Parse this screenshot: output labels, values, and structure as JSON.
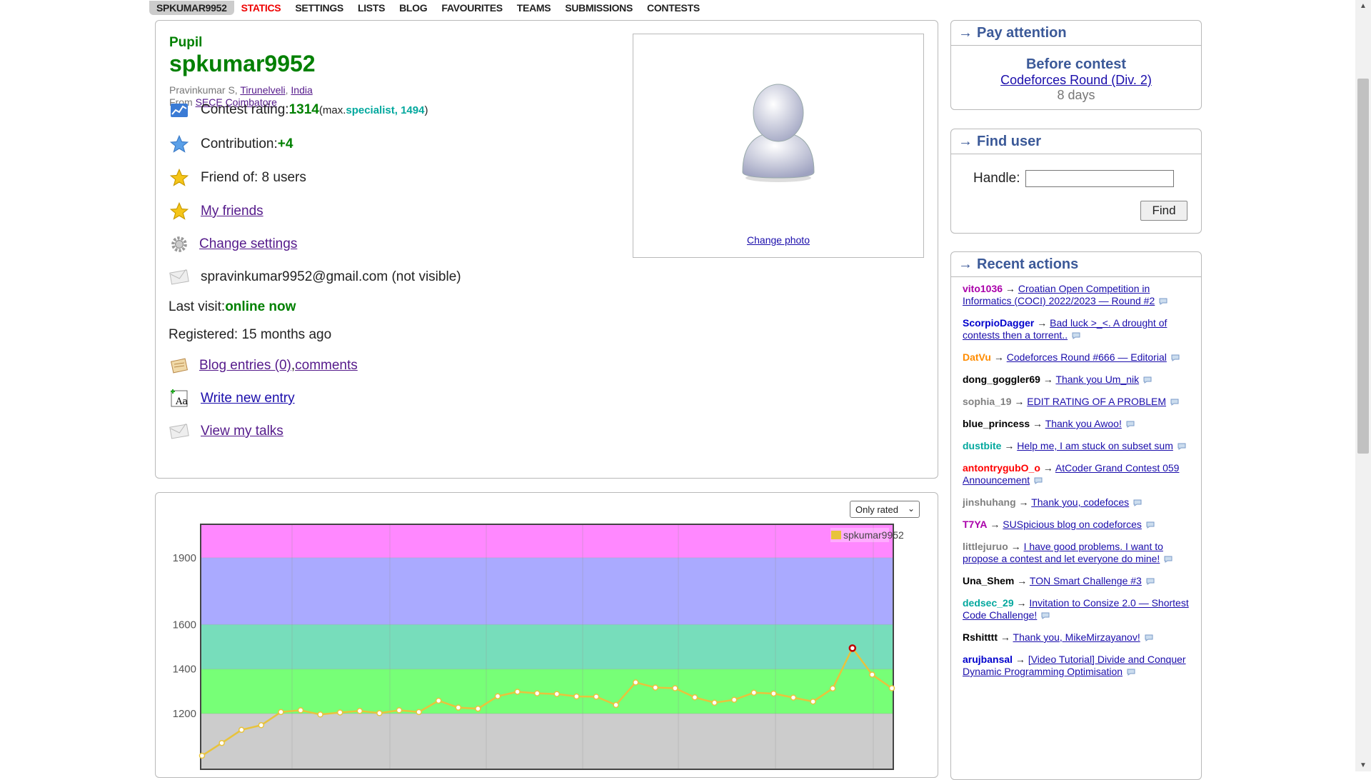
{
  "menu": {
    "items": [
      {
        "label": "SPKUMAR9952",
        "style": "active"
      },
      {
        "label": "STATICS",
        "style": "red"
      },
      {
        "label": "SETTINGS",
        "style": ""
      },
      {
        "label": "LISTS",
        "style": ""
      },
      {
        "label": "BLOG",
        "style": ""
      },
      {
        "label": "FAVOURITES",
        "style": ""
      },
      {
        "label": "TEAMS",
        "style": ""
      },
      {
        "label": "SUBMISSIONS",
        "style": ""
      },
      {
        "label": "CONTESTS",
        "style": ""
      }
    ]
  },
  "profile": {
    "rank": "Pupil",
    "handle": "spkumar9952",
    "name": "Pravinkumar S, ",
    "city": "Tirunelveli",
    "sep": ", ",
    "country": "India",
    "from_prefix": "From ",
    "org": "SECE Coimbatore",
    "contest_rating_label": "Contest rating: ",
    "contest_rating": "1314",
    "max_prefix": " (max. ",
    "max_rank": "specialist, 1494",
    "max_suffix": ")",
    "contribution_label": "Contribution: ",
    "contribution": "+4",
    "friend_of": "Friend of: 8 users",
    "my_friends": "My friends",
    "change_settings": "Change settings",
    "email": "spravinkumar9952@gmail.com (not visible)",
    "last_visit_label": "Last visit: ",
    "last_visit": "online now",
    "registered": "Registered: 15 months ago",
    "blog_entries": "Blog entries (0)",
    "comma": ", ",
    "comments": "comments",
    "write_entry": "Write new entry",
    "view_talks": "View my talks",
    "change_photo": "Change photo"
  },
  "chart_select": "Only rated",
  "chart_data": {
    "type": "line",
    "series": [
      {
        "name": "spkumar9952",
        "values": [
          1011,
          1068,
          1127,
          1148,
          1207,
          1215,
          1196,
          1205,
          1212,
          1202,
          1215,
          1207,
          1258,
          1227,
          1222,
          1278,
          1298,
          1291,
          1288,
          1277,
          1276,
          1239,
          1340,
          1317,
          1314,
          1273,
          1249,
          1262,
          1294,
          1290,
          1272,
          1254,
          1313,
          1494,
          1375,
          1314
        ],
        "color": "#e8c33c"
      }
    ],
    "highlight": {
      "value": 1494,
      "color": "#c00000"
    },
    "ylim": [
      950,
      2050
    ],
    "yticks": [
      1200,
      1400,
      1600,
      1900
    ],
    "bands": [
      {
        "from": 950,
        "to": 1200,
        "color": "#cccccc"
      },
      {
        "from": 1200,
        "to": 1400,
        "color": "#77ff77"
      },
      {
        "from": 1400,
        "to": 1600,
        "color": "#77ddbb"
      },
      {
        "from": 1600,
        "to": 1900,
        "color": "#aaaaff"
      },
      {
        "from": 1900,
        "to": 2050,
        "color": "#ff88ff"
      }
    ],
    "grid": true,
    "legend": "top-right"
  },
  "sidebar": {
    "attention": {
      "title": "Pay attention",
      "line1": "Before contest",
      "line2": "Codeforces Round (Div. 2)",
      "line3": "8 days"
    },
    "find": {
      "title": "Find user",
      "label": "Handle:",
      "button": "Find"
    },
    "recent": {
      "title": "Recent actions",
      "items": [
        {
          "user": "vito1036",
          "color": "#a0a",
          "text": "Croatian Open Competition in Informatics (COCI) 2022/2023 — Round #2"
        },
        {
          "user": "ScorpioDagger",
          "color": "#00c",
          "text": "Bad luck >_<. A drought of contests then a torrent.."
        },
        {
          "user": "DatVu",
          "color": "#ff8c00",
          "text": "Codeforces Round #666 — Editorial"
        },
        {
          "user": "dong_goggler69",
          "color": "#000",
          "text": "Thank you Um_nik"
        },
        {
          "user": "sophia_19",
          "color": "#808080",
          "text": "EDIT RATING OF A PROBLEM"
        },
        {
          "user": "blue_princess",
          "color": "#000",
          "text": "Thank you Awoo!"
        },
        {
          "user": "dustbite",
          "color": "#03a89e",
          "text": "Help me, I am stuck on subset sum"
        },
        {
          "user": "antontrygubO_o",
          "color": "#f00",
          "text": "AtCoder Grand Contest 059 Announcement"
        },
        {
          "user": "jinshuhang",
          "color": "#808080",
          "text": "Thank you, codefoces"
        },
        {
          "user": "T7YA",
          "color": "#a0a",
          "text": "SUSpicious blog on codeforces"
        },
        {
          "user": "littlejuruo",
          "color": "#808080",
          "text": "I have good problems. I want to propose a contest and let everyone do mine!"
        },
        {
          "user": "Una_Shem",
          "color": "#000",
          "text": "TON Smart Challenge #3"
        },
        {
          "user": "dedsec_29",
          "color": "#03a89e",
          "text": "Invitation to Consize 2.0 — Shortest Code Challenge!"
        },
        {
          "user": "Rshitttt",
          "color": "#000",
          "text": "Thank you, MikeMirzayanov!"
        },
        {
          "user": "arujbansal",
          "color": "#00c",
          "text": "[Video Tutorial] Divide and Conquer Dynamic Programming Optimisation"
        }
      ]
    }
  }
}
